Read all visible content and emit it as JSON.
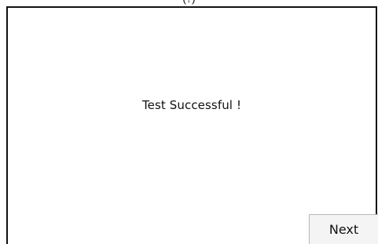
{
  "window": {
    "title_fragment": "(?)"
  },
  "main": {
    "message": "Test Successful !"
  },
  "footer": {
    "next_label": "Next"
  }
}
